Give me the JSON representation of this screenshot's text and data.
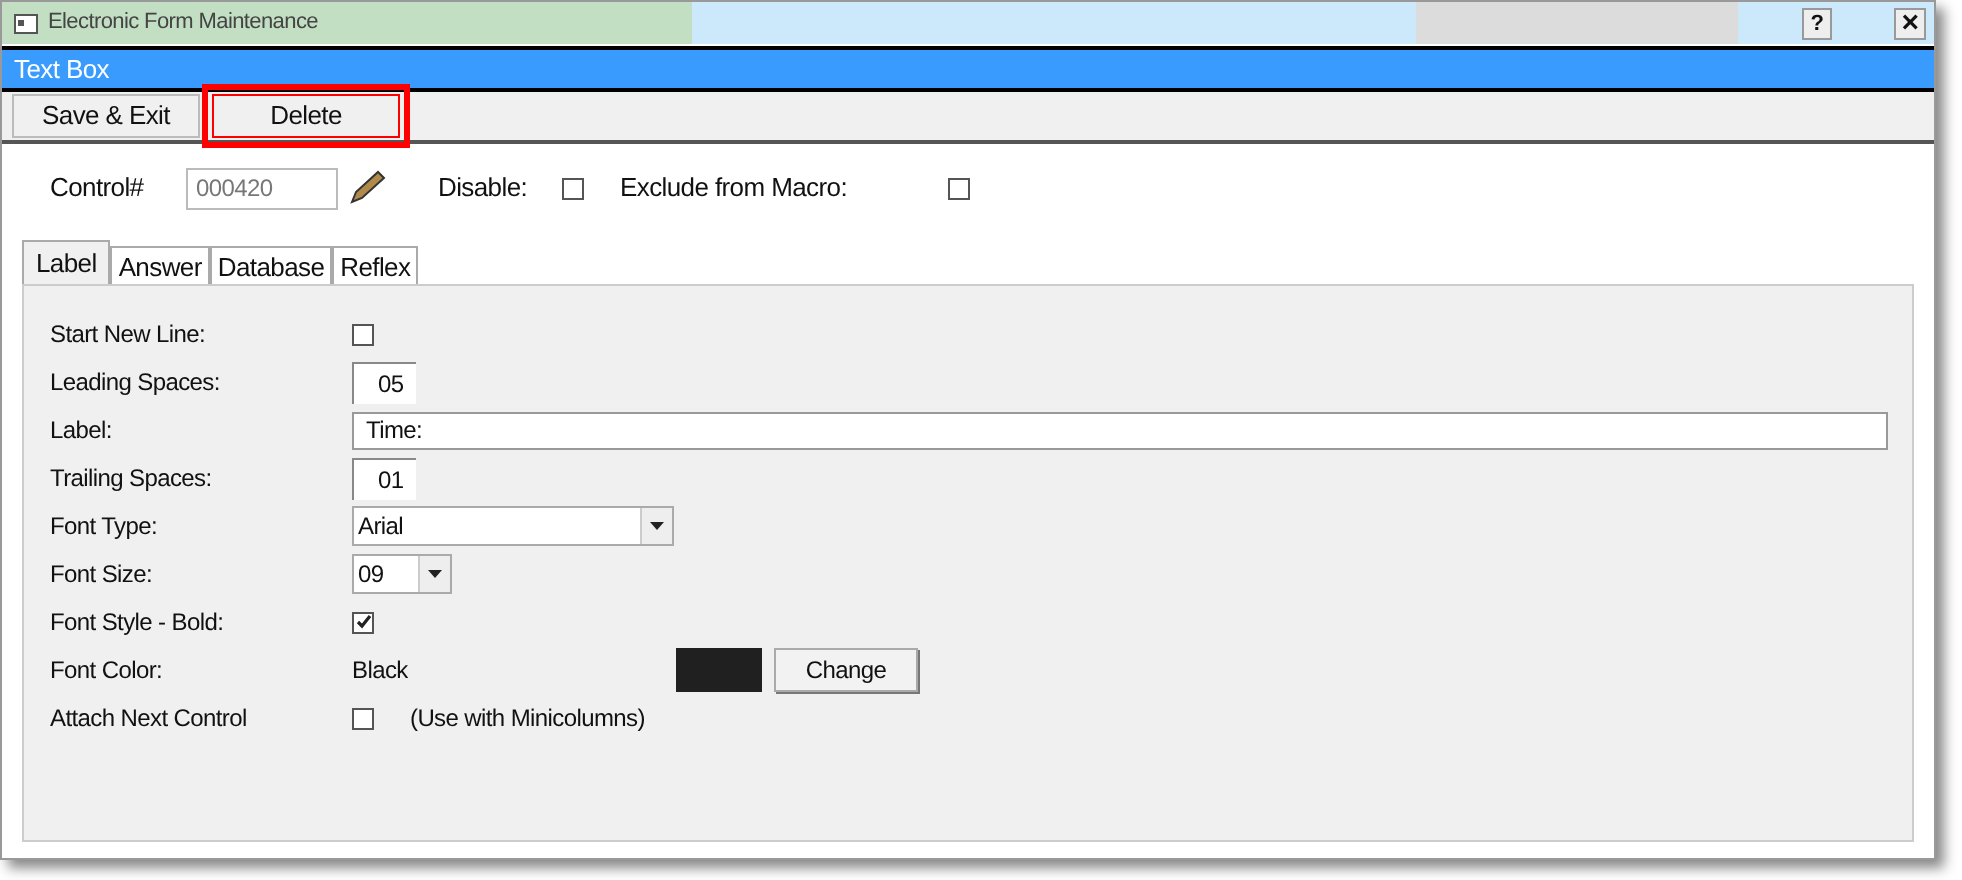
{
  "window": {
    "title": "Electronic Form Maintenance",
    "help": "?",
    "close": "×"
  },
  "header": {
    "title": "Text Box"
  },
  "toolbar": [
    {
      "label": "Save & Exit",
      "highlighted": false
    },
    {
      "label": "Delete",
      "highlighted": true
    }
  ],
  "control": {
    "label": "Control#",
    "value": "000420",
    "disable_label": "Disable:",
    "disable_checked": false,
    "exclude_label": "Exclude from Macro:",
    "exclude_checked": false
  },
  "tabs": [
    {
      "label": "Label",
      "selected": true
    },
    {
      "label": "Answer",
      "selected": false
    },
    {
      "label": "Database",
      "selected": false
    },
    {
      "label": "Reflex",
      "selected": false
    }
  ],
  "fields": [
    {
      "kind": "checkbox",
      "label": "Start New Line:",
      "checked": false
    },
    {
      "kind": "number",
      "label": "Leading Spaces:",
      "value": "05"
    },
    {
      "kind": "text",
      "label": "Label:",
      "value": "Time:"
    },
    {
      "kind": "number",
      "label": "Trailing Spaces:",
      "value": "01"
    },
    {
      "kind": "select",
      "label": "Font Type:",
      "value": "Arial"
    },
    {
      "kind": "small-select",
      "label": "Font Size:",
      "value": "09"
    },
    {
      "kind": "checkbox",
      "label": "Font Style - Bold:",
      "checked": true
    },
    {
      "kind": "color",
      "label": "Font Color:",
      "value": "Black",
      "color": "#202020",
      "button": "Change"
    },
    {
      "kind": "checkbox",
      "label": "Attach Next Control",
      "checked": false,
      "note": "(Use with Minicolumns)"
    }
  ]
}
